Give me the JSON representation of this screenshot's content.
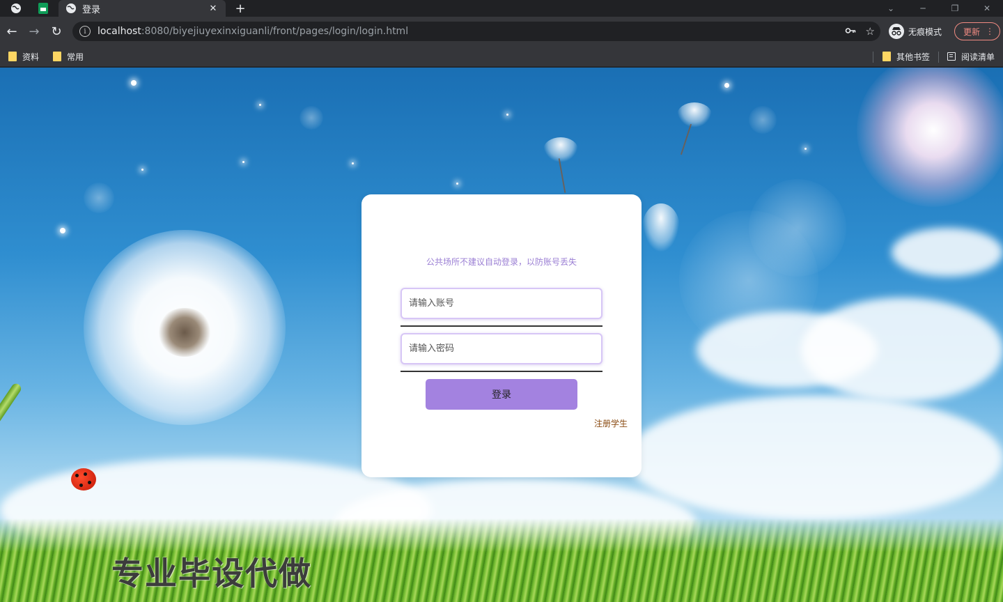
{
  "browser": {
    "active_tab_title": "登录",
    "new_tab_symbol": "+",
    "url_host": "localhost",
    "url_rest": ":8080/biyejiuyexinxiguanli/front/pages/login/login.html",
    "incognito_label": "无痕模式",
    "update_label": "更新",
    "bookmarks": [
      {
        "label": "资料",
        "icon": "folder-icon"
      },
      {
        "label": "常用",
        "icon": "folder-icon"
      }
    ],
    "other_bookmarks_label": "其他书签",
    "reading_list_label": "阅读清单"
  },
  "login": {
    "notice": "公共场所不建议自动登录，以防账号丢失",
    "account_placeholder": "请输入账号",
    "password_placeholder": "请输入密码",
    "login_button": "登录",
    "register_link": "注册学生"
  },
  "watermark_text": "专业毕设代做",
  "colors": {
    "accent": "#a382e0",
    "notice_text": "#9b7fd4",
    "input_border": "#d7c6f6",
    "register_link": "#8a4b12"
  }
}
